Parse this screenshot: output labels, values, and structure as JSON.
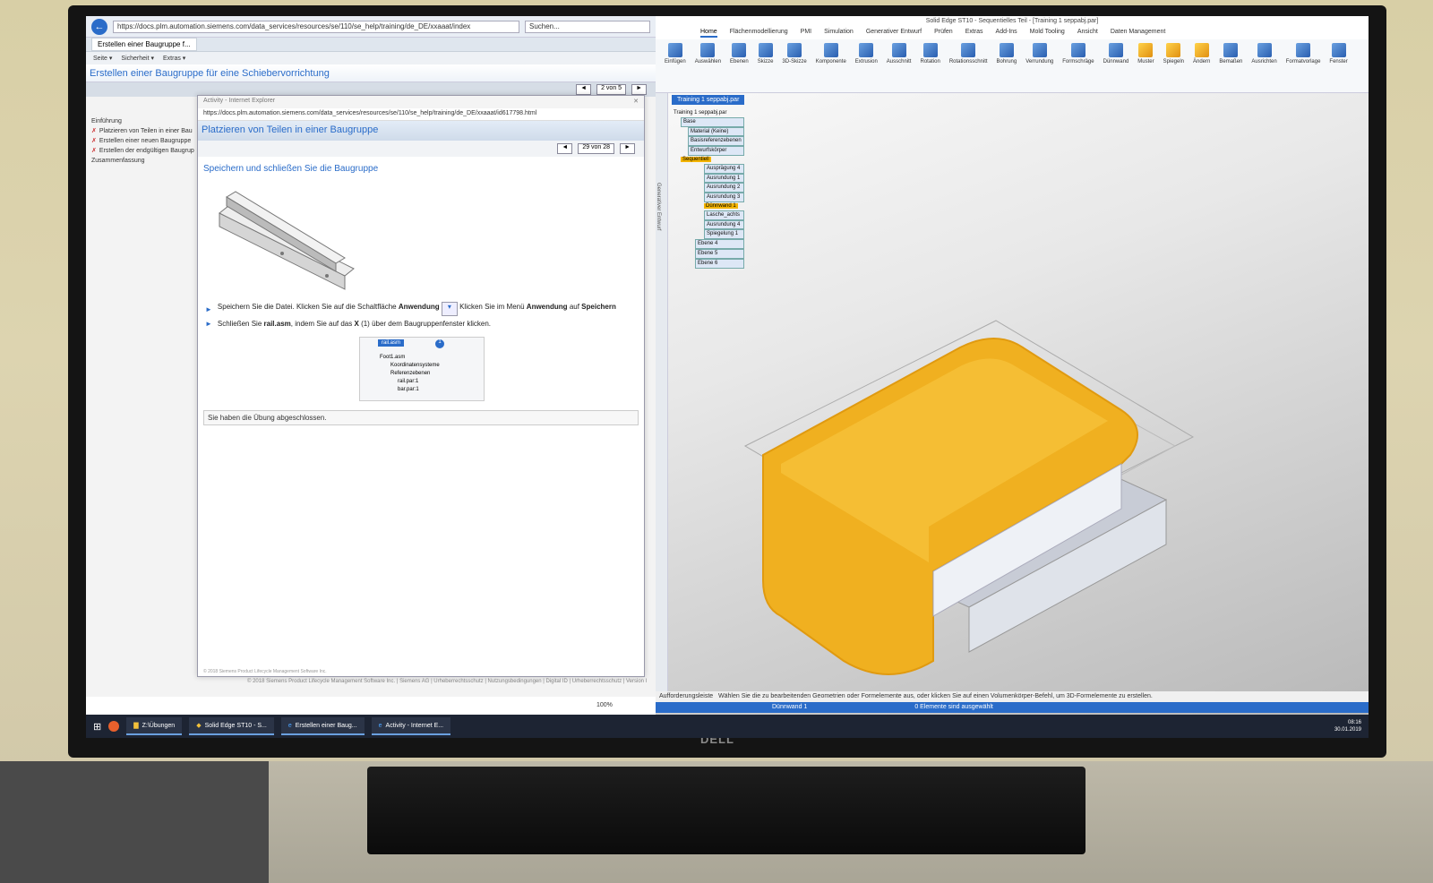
{
  "browser": {
    "address": "https://docs.plm.automation.siemens.com/data_services/resources/se/110/se_help/training/de_DE/xxaaat/index",
    "search_placeholder": "Suchen...",
    "tab_title": "Erstellen einer Baugruppe f...",
    "commands": [
      "Seite ▾",
      "Sicherheit ▾",
      "Extras ▾"
    ],
    "page_title": "Erstellen einer Baugruppe für eine Schiebervorrichtung",
    "page_counter": "2 von 5",
    "toc": [
      "Einführung",
      "Platzieren von Teilen in einer Bau",
      "Erstellen einer neuen Baugruppe",
      "Erstellen der endgültigen Baugrup",
      "Zusammenfassung"
    ],
    "footer": "© 2018 Siemens Product Lifecycle Management Software Inc. | Siemens AG | Urheberrechtsschutz | Nutzungsbedingungen | Digital ID | Urheberrechtsschutz | Version I"
  },
  "popup": {
    "title": "Activity - Internet Explorer",
    "address": "https://docs.plm.automation.siemens.com/data_services/resources/se/110/se_help/training/de_DE/xxaaat/id617798.html",
    "heading": "Platzieren von Teilen in einer Baugruppe",
    "counter": "29 von 28",
    "section": "Speichern und schließen Sie die Baugruppe",
    "step1_a": "Speichern Sie die Datei. Klicken Sie auf die Schaltfläche",
    "step1_b": "Anwendung",
    "step1_c": "Klicken Sie im Menü",
    "step1_d": "Anwendung",
    "step1_e": "auf",
    "step1_f": "Speichern",
    "step2_a": "Schließen Sie",
    "step2_b": "rail.asm",
    "step2_c": ", indem Sie auf das",
    "step2_d": "X",
    "step2_e": "(1) über dem Baugruppenfenster klicken.",
    "tree_tab": "rail.asm",
    "tree_items": [
      "Foot1.asm",
      "Koordinatensysteme",
      "Referenzebenen",
      "rail.par:1",
      "bar.par:1"
    ],
    "done": "Sie haben die Übung abgeschlossen.",
    "footer": "© 2018 Siemens Product Lifecycle Management Software Inc."
  },
  "solidedge": {
    "title": "Solid Edge ST10 - Sequentielles Teil - [Training 1 seppabj.par]",
    "tabs": [
      "Home",
      "Flächenmodellierung",
      "PMI",
      "Simulation",
      "Generativer Entwurf",
      "Prüfen",
      "Extras",
      "Add-Ins",
      "Mold Tooling",
      "Ansicht",
      "Daten Management"
    ],
    "ribbon": [
      "Einfügen",
      "Auswählen",
      "Ebenen",
      "Skizze",
      "3D-Skizze",
      "Komponente",
      "Extrusion",
      "Ausschnitt",
      "Rotation",
      "Rotationsschnitt",
      "Bohrung",
      "Verrundung",
      "Formschräge",
      "Dünnwand",
      "Muster",
      "Spiegeln",
      "Ändern",
      "Bemaßen",
      "Ausrichten",
      "Formatvorlage",
      "Fenster"
    ],
    "doc_tab": "Training 1 seppabj.par",
    "tree": [
      "Training 1 seppabj.par",
      "Base",
      "Material (Keine)",
      "Basisreferenzebenen",
      "Entwurfskörper",
      "Sequentiell",
      "Ausprägung 4",
      "Ausrundung 1",
      "Ausrundung 2",
      "Ausrundung 3",
      "Dünnwand 1",
      "Lasche_achts",
      "Ausrundung 4",
      "Spiegelung 1",
      "Ebene 4",
      "Ebene 5",
      "Ebene 6"
    ],
    "prompt_label": "Aufforderungsleiste",
    "prompt": "Wählen Sie die zu bearbeitenden Geometrien oder Formelemente aus, oder klicken Sie auf einen Volumenkörper-Befehl, um 3D-Formelemente zu erstellen.",
    "status_left": "Dünnwand 1",
    "status_mid": "0 Elemente sind ausgewählt",
    "side_label": "Generativer Entwurf"
  },
  "taskbar": {
    "items": [
      "Z:\\Übungen",
      "Solid Edge ST10 - S...",
      "Erstellen einer Baug...",
      "Activity - Internet E..."
    ],
    "time": "08:16",
    "date": "30.01.2019"
  },
  "zoom": "100%",
  "colors": {
    "accent": "#2a6cc9",
    "highlight": "#f3b400"
  },
  "brand": "DELL"
}
